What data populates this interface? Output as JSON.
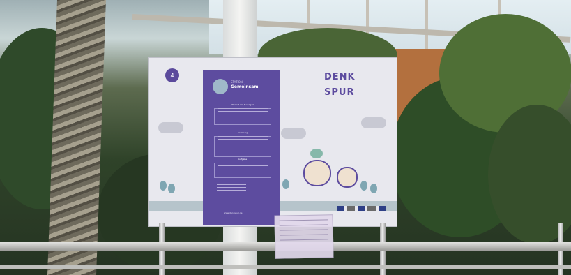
{
  "sign": {
    "board_number": "4",
    "panel_kicker": "STATION",
    "panel_title": "Gemeinsam",
    "section_1_heading": "Was ist die Aussage?",
    "section_2_heading": "Anleitung",
    "section_3_heading": "Aufgabe",
    "brand_line_1": "DENK",
    "brand_line_2": "SPUR",
    "website": "www.denkspur.de"
  },
  "colors": {
    "brand_purple": "#5d4c9f",
    "board_background": "#e8e8ee"
  },
  "icons": {
    "mascot_left": "brain-mascot-with-glasses",
    "mascot_right": "cat-mascot-with-sunglasses",
    "heart": "heart-balloon"
  }
}
